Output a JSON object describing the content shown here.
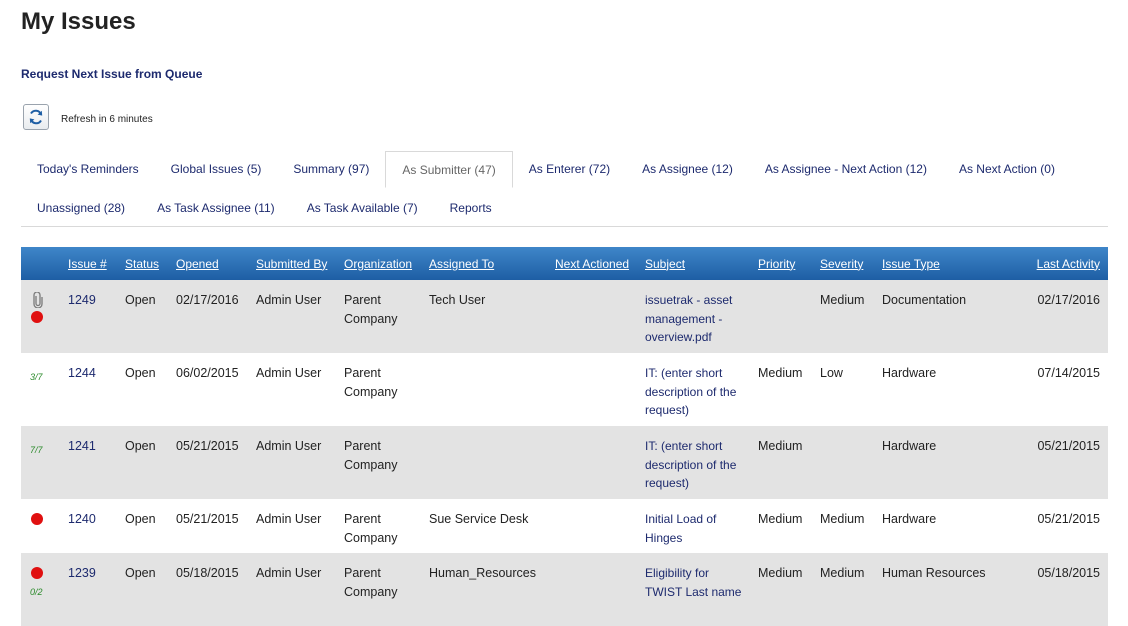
{
  "page": {
    "title": "My Issues",
    "queue_link": "Request Next Issue from Queue",
    "refresh_text": "Refresh in 6 minutes"
  },
  "tabs": {
    "row1": [
      "Today's Reminders",
      "Global Issues (5)",
      "Summary (97)",
      "As Submitter (47)",
      "As Enterer (72)",
      "As Assignee (12)",
      "As Assignee - Next Action (12)",
      "As Next Action (0)"
    ],
    "row2": [
      "Unassigned (28)",
      "As Task Assignee (11)",
      "As Task Available (7)",
      "Reports"
    ],
    "active": "As Submitter (47)"
  },
  "table": {
    "columns": {
      "issue": "Issue #",
      "status": "Status",
      "opened": "Opened",
      "submitted_by": "Submitted By",
      "organization": "Organization",
      "assigned_to": "Assigned To",
      "next_actioned": "Next Actioned",
      "subject": "Subject",
      "priority": "Priority",
      "severity": "Severity",
      "issue_type": "Issue Type",
      "last_activity": "Last Activity"
    },
    "rows": [
      {
        "indicator": "",
        "issue": "1249",
        "status": "Open",
        "opened": "02/17/2016",
        "submitted_by": "Admin User",
        "organization": "Parent Company",
        "assigned_to": "Tech User",
        "next_actioned": "",
        "subject": "issuetrak - asset management - overview.pdf",
        "priority": "",
        "severity": "Medium",
        "issue_type": "Documentation",
        "last_activity": "02/17/2016"
      },
      {
        "indicator": "3/7",
        "issue": "1244",
        "status": "Open",
        "opened": "06/02/2015",
        "submitted_by": "Admin User",
        "organization": "Parent Company",
        "assigned_to": "",
        "next_actioned": "",
        "subject": "IT: (enter short description of the request)",
        "priority": "Medium",
        "severity": "Low",
        "issue_type": "Hardware",
        "last_activity": "07/14/2015"
      },
      {
        "indicator": "7/7",
        "issue": "1241",
        "status": "Open",
        "opened": "05/21/2015",
        "submitted_by": "Admin User",
        "organization": "Parent Company",
        "assigned_to": "",
        "next_actioned": "",
        "subject": "IT: (enter short description of the request)",
        "priority": "Medium",
        "severity": "",
        "issue_type": "Hardware",
        "last_activity": "05/21/2015"
      },
      {
        "indicator": "",
        "issue": "1240",
        "status": "Open",
        "opened": "05/21/2015",
        "submitted_by": "Admin User",
        "organization": "Parent Company",
        "assigned_to": "Sue Service Desk",
        "next_actioned": "",
        "subject": "Initial Load of Hinges",
        "priority": "Medium",
        "severity": "Medium",
        "issue_type": "Hardware",
        "last_activity": "05/21/2015"
      },
      {
        "indicator": "0/2",
        "issue": "1239",
        "status": "Open",
        "opened": "05/18/2015",
        "submitted_by": "Admin User",
        "organization": "Parent Company",
        "assigned_to": "Human_Resources",
        "next_actioned": "",
        "subject": "Eligibility for TWIST Last name",
        "priority": "Medium",
        "severity": "Medium",
        "issue_type": "Human Resources",
        "last_activity": "05/18/2015"
      }
    ]
  },
  "icons": {
    "refresh": "refresh-icon",
    "attachment": "paperclip-icon",
    "alert": "red-dot-icon"
  },
  "colors": {
    "link": "#1d2a6e",
    "header_top": "#3f86c9",
    "header_bottom": "#1e5ea4",
    "row_shade": "#e3e3e3",
    "alert_dot": "#e01010",
    "task_fraction": "#2a8a2a"
  }
}
